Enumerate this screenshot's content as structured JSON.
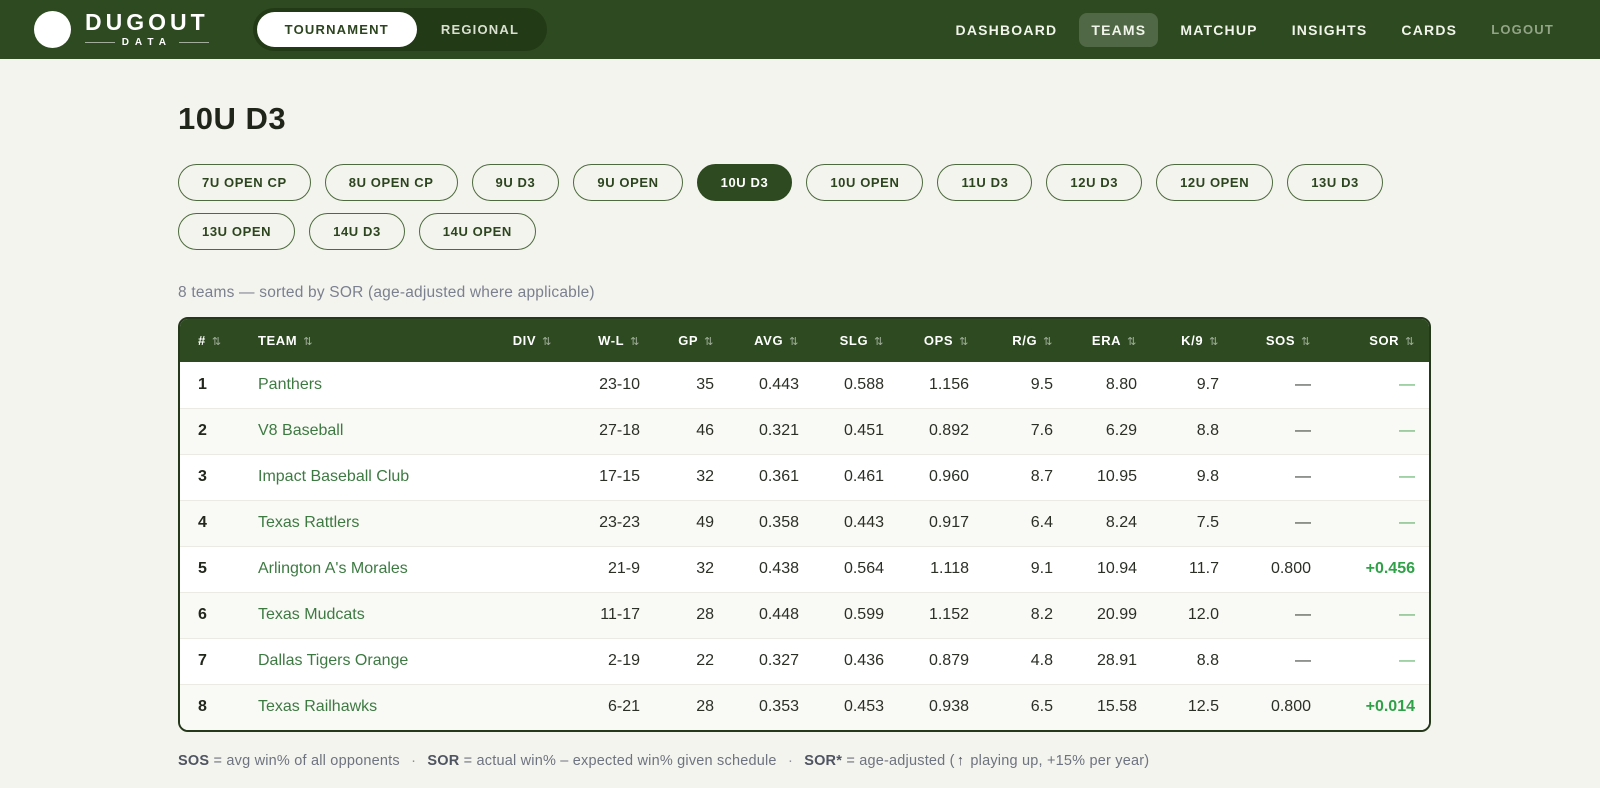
{
  "brand": {
    "name": "DUGOUT",
    "sub": "DATA"
  },
  "header": {
    "toggle": [
      {
        "label": "TOURNAMENT",
        "active": true
      },
      {
        "label": "REGIONAL",
        "active": false
      }
    ],
    "nav": [
      {
        "label": "DASHBOARD",
        "active": false,
        "muted": false
      },
      {
        "label": "TEAMS",
        "active": true,
        "muted": false
      },
      {
        "label": "MATCHUP",
        "active": false,
        "muted": false
      },
      {
        "label": "INSIGHTS",
        "active": false,
        "muted": false
      },
      {
        "label": "CARDS",
        "active": false,
        "muted": false
      },
      {
        "label": "LOGOUT",
        "active": false,
        "muted": true
      }
    ]
  },
  "page": {
    "title": "10U D3",
    "subtitle": "8 teams — sorted by SOR (age-adjusted where applicable)"
  },
  "filters": [
    {
      "label": "7U OPEN CP",
      "active": false
    },
    {
      "label": "8U OPEN CP",
      "active": false
    },
    {
      "label": "9U D3",
      "active": false
    },
    {
      "label": "9U OPEN",
      "active": false
    },
    {
      "label": "10U D3",
      "active": true
    },
    {
      "label": "10U OPEN",
      "active": false
    },
    {
      "label": "11U D3",
      "active": false
    },
    {
      "label": "12U D3",
      "active": false
    },
    {
      "label": "12U OPEN",
      "active": false
    },
    {
      "label": "13U D3",
      "active": false
    },
    {
      "label": "13U OPEN",
      "active": false
    },
    {
      "label": "14U D3",
      "active": false
    },
    {
      "label": "14U OPEN",
      "active": false
    }
  ],
  "table": {
    "sort_icon": "⇅",
    "columns": [
      {
        "key": "rank",
        "label": "#"
      },
      {
        "key": "team",
        "label": "TEAM"
      },
      {
        "key": "div",
        "label": "DIV"
      },
      {
        "key": "wl",
        "label": "W-L"
      },
      {
        "key": "gp",
        "label": "GP"
      },
      {
        "key": "avg",
        "label": "AVG"
      },
      {
        "key": "slg",
        "label": "SLG"
      },
      {
        "key": "ops",
        "label": "OPS"
      },
      {
        "key": "rg",
        "label": "R/G"
      },
      {
        "key": "era",
        "label": "ERA"
      },
      {
        "key": "k9",
        "label": "K/9"
      },
      {
        "key": "sos",
        "label": "SOS"
      },
      {
        "key": "sor",
        "label": "SOR"
      }
    ],
    "rows": [
      {
        "rank": "1",
        "team": "Panthers",
        "div": "",
        "wl": "23-10",
        "gp": "35",
        "avg": "0.443",
        "slg": "0.588",
        "ops": "1.156",
        "rg": "9.5",
        "era": "8.80",
        "k9": "9.7",
        "sos": "—",
        "sor": "—"
      },
      {
        "rank": "2",
        "team": "V8 Baseball",
        "div": "",
        "wl": "27-18",
        "gp": "46",
        "avg": "0.321",
        "slg": "0.451",
        "ops": "0.892",
        "rg": "7.6",
        "era": "6.29",
        "k9": "8.8",
        "sos": "—",
        "sor": "—"
      },
      {
        "rank": "3",
        "team": "Impact Baseball Club",
        "div": "",
        "wl": "17-15",
        "gp": "32",
        "avg": "0.361",
        "slg": "0.461",
        "ops": "0.960",
        "rg": "8.7",
        "era": "10.95",
        "k9": "9.8",
        "sos": "—",
        "sor": "—"
      },
      {
        "rank": "4",
        "team": "Texas Rattlers",
        "div": "",
        "wl": "23-23",
        "gp": "49",
        "avg": "0.358",
        "slg": "0.443",
        "ops": "0.917",
        "rg": "6.4",
        "era": "8.24",
        "k9": "7.5",
        "sos": "—",
        "sor": "—"
      },
      {
        "rank": "5",
        "team": "Arlington A's Morales",
        "div": "",
        "wl": "21-9",
        "gp": "32",
        "avg": "0.438",
        "slg": "0.564",
        "ops": "1.118",
        "rg": "9.1",
        "era": "10.94",
        "k9": "11.7",
        "sos": "0.800",
        "sor": "+0.456"
      },
      {
        "rank": "6",
        "team": "Texas Mudcats",
        "div": "",
        "wl": "11-17",
        "gp": "28",
        "avg": "0.448",
        "slg": "0.599",
        "ops": "1.152",
        "rg": "8.2",
        "era": "20.99",
        "k9": "12.0",
        "sos": "—",
        "sor": "—"
      },
      {
        "rank": "7",
        "team": "Dallas Tigers Orange",
        "div": "",
        "wl": "2-19",
        "gp": "22",
        "avg": "0.327",
        "slg": "0.436",
        "ops": "0.879",
        "rg": "4.8",
        "era": "28.91",
        "k9": "8.8",
        "sos": "—",
        "sor": "—"
      },
      {
        "rank": "8",
        "team": "Texas Railhawks",
        "div": "",
        "wl": "6-21",
        "gp": "28",
        "avg": "0.353",
        "slg": "0.453",
        "ops": "0.938",
        "rg": "6.5",
        "era": "15.58",
        "k9": "12.5",
        "sos": "0.800",
        "sor": "+0.014"
      }
    ]
  },
  "legend": {
    "sos_term": "SOS",
    "sos_def": "= avg win% of all opponents",
    "dot": "·",
    "sor_term": "SOR",
    "sor_def": "= actual win% – expected win% given schedule",
    "sor_star_term": "SOR*",
    "sor_star_def_pre": "= age-adjusted (",
    "up_arrow": "↑",
    "sor_star_def_post": "playing up, +15% per year)"
  }
}
